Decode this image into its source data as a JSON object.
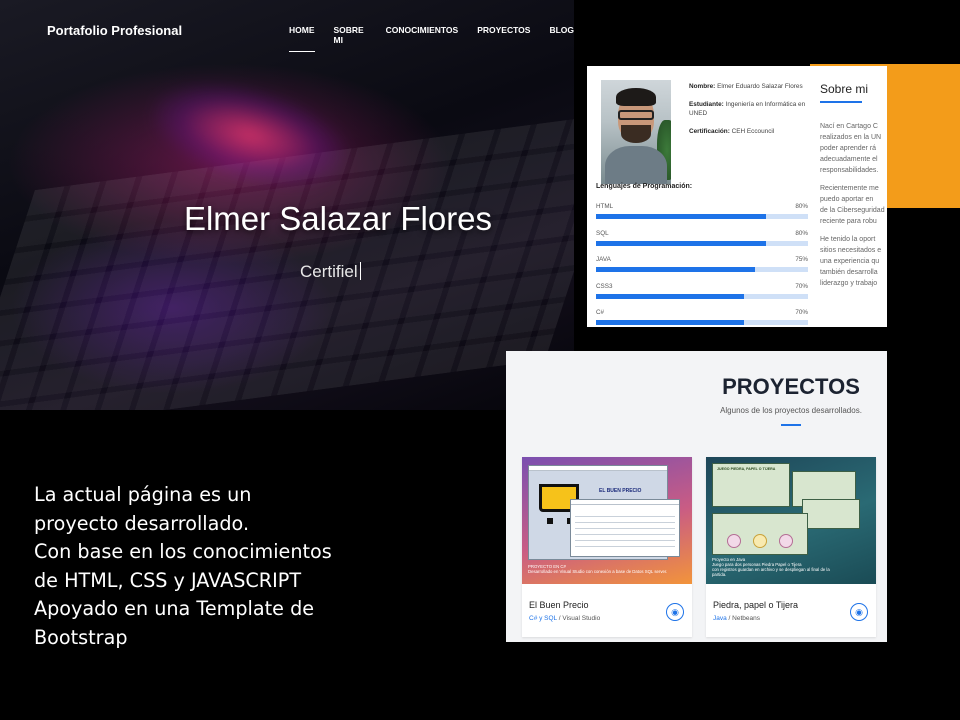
{
  "hero": {
    "brand": "Portafolio Profesional",
    "nav": [
      "HOME",
      "SOBRE MI",
      "CONOCIMIENTOS",
      "PROYECTOS",
      "BLOG"
    ],
    "name": "Elmer Salazar Flores",
    "subtitle": "Certifiel"
  },
  "description": [
    "La actual página es un",
    "proyecto desarrollado.",
    "Con base en los conocimientos",
    "de HTML, CSS y JAVASCRIPT",
    "Apoyado en una Template de",
    "Bootstrap"
  ],
  "about": {
    "name_label": "Nombre:",
    "name_value": "Elmer Eduardo Salazar Flores",
    "student_label": "Estudiante:",
    "student_value": "Ingeniería en Informática en UNED",
    "cert_label": "Certificación:",
    "cert_value": "CEH Eccouncil",
    "skills_title": "Lenguajes de Programación:",
    "skills": [
      {
        "name": "HTML",
        "percent": 80,
        "label": "80%"
      },
      {
        "name": "SQL",
        "percent": 80,
        "label": "80%"
      },
      {
        "name": "JAVA",
        "percent": 75,
        "label": "75%"
      },
      {
        "name": "CSS3",
        "percent": 70,
        "label": "70%"
      },
      {
        "name": "C#",
        "percent": 70,
        "label": "70%"
      }
    ],
    "heading": "Sobre mi",
    "paragraphs": [
      [
        "Nací en Cartago C",
        "realizados en la UN",
        "poder aprender rá",
        "adecuadamente el",
        "responsabilidades."
      ],
      [
        "Recientemente me",
        "puedo aportar en",
        "de la Ciberseguridad",
        "reciente para robu"
      ],
      [
        "He tenido la oport",
        "sitios necesitados e",
        "una experiencia qu",
        "también desarrolla",
        "liderazgo y trabajo"
      ]
    ]
  },
  "projects": {
    "title": "PROYECTOS",
    "subtitle": "Algunos de los proyectos desarrollados.",
    "items": [
      {
        "name": "El Buen Precio",
        "tag_lang": "C# y SQL",
        "tag_sep": " / ",
        "tag_tool": "Visual Studio",
        "thumb_title": "EL BUEN PRECIO",
        "caption": [
          "PROYECTO EN C#",
          "Desarrollado en Visual Studio con conexión a base de Datos SQL server."
        ]
      },
      {
        "name": "Piedra, papel o Tijera",
        "tag_lang": "Java",
        "tag_sep": " / ",
        "tag_tool": "Netbeans",
        "thumb_title": "JUEGO PIEDRA, PAPEL O TIJERA",
        "caption": [
          "Proyecto en Java",
          "Juego para dos personas Piedra Papel o Tijera",
          "con registros guardan en archivo y se despliegan al final de la",
          "partida."
        ]
      }
    ]
  },
  "colors": {
    "accent": "#1e73e8",
    "orange": "#f39c1a",
    "background": "#000000"
  }
}
